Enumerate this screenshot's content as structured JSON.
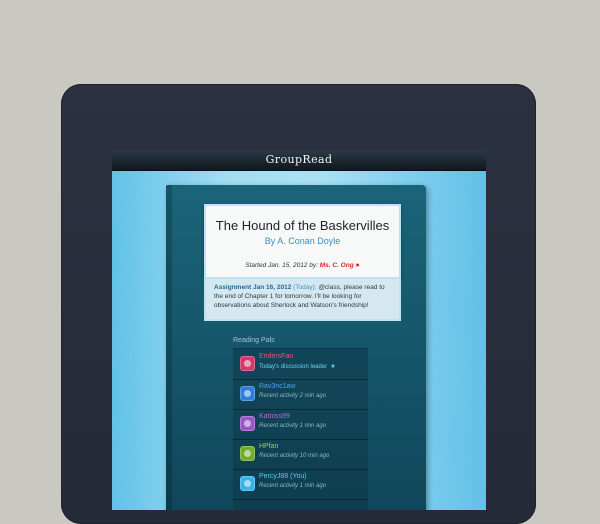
{
  "app": {
    "title": "GroupRead"
  },
  "book": {
    "title": "The Hound of the Baskervilles",
    "author": "By A. Conan Doyle",
    "started_prefix": "Started Jan. 15, 2012 by: ",
    "started_by": "Ms. C. Ong",
    "apple_icon": "apple-icon"
  },
  "assignment": {
    "date": "Assignment Jan 16, 2012",
    "today": "(Today):",
    "text": "@class, please read to the end of Chapter 1 for tomorrow. I'll be looking for observations about Sherlock and Watson's friendship!"
  },
  "pals": {
    "heading": "Reading Pals",
    "items": [
      {
        "name": "EndersFan",
        "status": "Today's discussion leader",
        "star": "★",
        "name_color": "#e0567a",
        "avatar_color": "#d33a6c"
      },
      {
        "name": "Rav3nc1aw",
        "status": "Recent activity 2 min ago",
        "name_color": "#4aa6ea",
        "avatar_color": "#2f7fd8"
      },
      {
        "name": "Katniss99",
        "status": "Recent activity 1 min ago",
        "name_color": "#b46ad8",
        "avatar_color": "#9a57c7"
      },
      {
        "name": "HPfan",
        "status": "Recent activity 10 min ago",
        "name_color": "#9ad04a",
        "avatar_color": "#6fae2c"
      },
      {
        "name": "PercyJ88 (You)",
        "status": "Recent activity 1 min ago",
        "name_color": "#5cc8f0",
        "avatar_color": "#3ab3e8"
      }
    ]
  }
}
